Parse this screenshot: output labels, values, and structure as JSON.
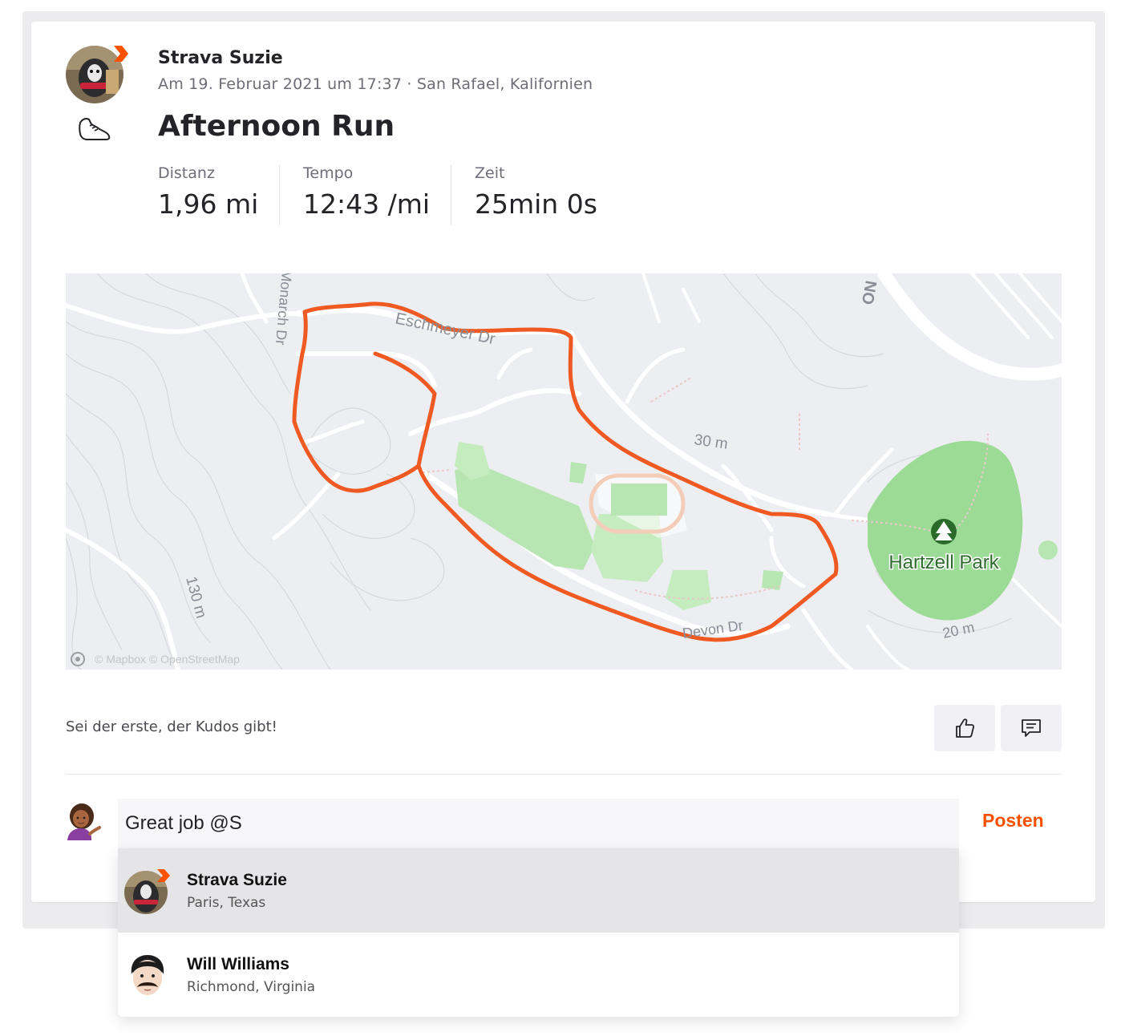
{
  "activity": {
    "athlete_name": "Strava Suzie",
    "meta": "Am 19. Februar 2021 um 17:37 · San Rafael, Kalifornien",
    "title": "Afternoon Run",
    "sport_icon": "running-shoe-icon",
    "stats": [
      {
        "label": "Distanz",
        "value": "1,96 mi"
      },
      {
        "label": "Tempo",
        "value": "12:43 /mi"
      },
      {
        "label": "Zeit",
        "value": "25min 0s"
      }
    ]
  },
  "map": {
    "labels": {
      "street_1": "Eschmeyer Dr",
      "street_2": "Devon Dr",
      "street_3": "Monarch Dr",
      "elevation_30": "30 m",
      "elevation_130": "130 m",
      "elevation_20": "20 m",
      "park": "Hartzell Park",
      "attribution": "© Mapbox © OpenStreetMap",
      "corner_road": "NO"
    },
    "colors": {
      "route": "#f05a22",
      "park": "#9cdb96",
      "background": "#eceef2"
    }
  },
  "social": {
    "kudos_text": "Sei der erste, der Kudos gibt!",
    "kudos_icon": "thumbs-up-icon",
    "comment_icon": "comment-icon"
  },
  "comment": {
    "value": "Great job @S",
    "post_label": "Posten"
  },
  "mentions": [
    {
      "name": "Strava Suzie",
      "location": "Paris, Texas"
    },
    {
      "name": "Will Williams",
      "location": "Richmond, Virginia"
    }
  ],
  "colors": {
    "accent": "#fc5200",
    "text": "#242428",
    "muted": "#6d6d78"
  }
}
